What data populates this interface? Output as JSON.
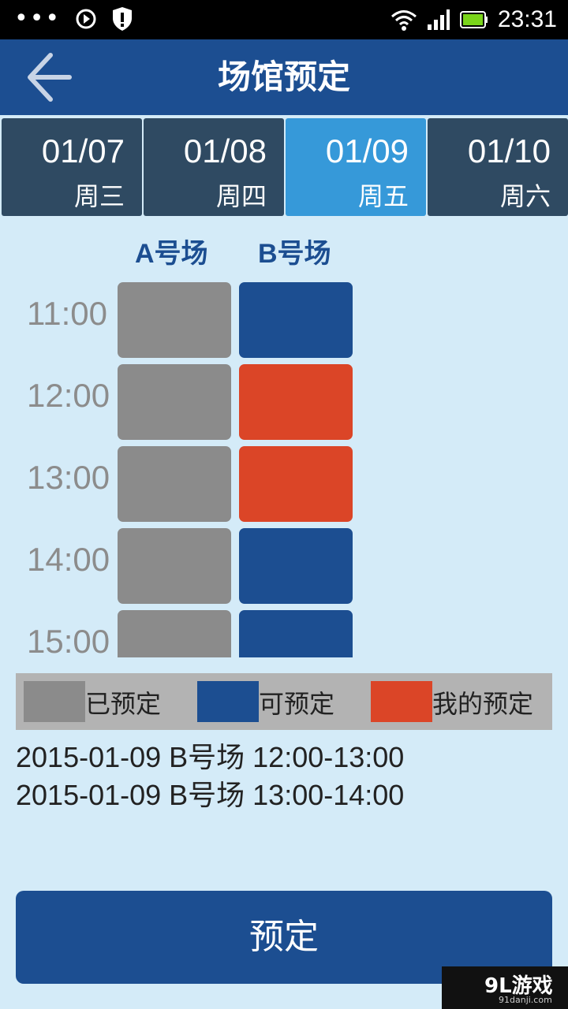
{
  "status_bar": {
    "time": "23:31",
    "icons": [
      "more-dots-icon",
      "play-icon",
      "shield-alert-icon",
      "wifi-icon",
      "signal-icon",
      "battery-icon"
    ]
  },
  "header": {
    "title": "场馆预定",
    "back_icon": "back-arrow-icon"
  },
  "date_tabs": [
    {
      "date": "01/07",
      "weekday": "周三",
      "selected": false
    },
    {
      "date": "01/08",
      "weekday": "周四",
      "selected": false
    },
    {
      "date": "01/09",
      "weekday": "周五",
      "selected": true
    },
    {
      "date": "01/10",
      "weekday": "周六",
      "selected": false
    }
  ],
  "courts": [
    "A号场",
    "B号场"
  ],
  "slots": [
    {
      "time": "11:00",
      "a": "booked",
      "b": "available"
    },
    {
      "time": "12:00",
      "a": "booked",
      "b": "mine"
    },
    {
      "time": "13:00",
      "a": "booked",
      "b": "mine"
    },
    {
      "time": "14:00",
      "a": "booked",
      "b": "available"
    },
    {
      "time": "15:00",
      "a": "booked",
      "b": "available"
    }
  ],
  "legend": {
    "booked": "已预定",
    "available": "可预定",
    "mine": "我的预定"
  },
  "colors": {
    "booked": "#8b8b8b",
    "available": "#1c4e91",
    "mine": "#db4527",
    "tab": "#2f4a62",
    "tab_active": "#3699d9",
    "primary": "#1c4e91",
    "background": "#d4ebf8"
  },
  "bookings": [
    "2015-01-09 B号场 12:00-13:00",
    "2015-01-09 B号场 13:00-14:00"
  ],
  "book_button": "预定",
  "watermark": {
    "logo": "9L游戏",
    "url": "91danji.com"
  }
}
